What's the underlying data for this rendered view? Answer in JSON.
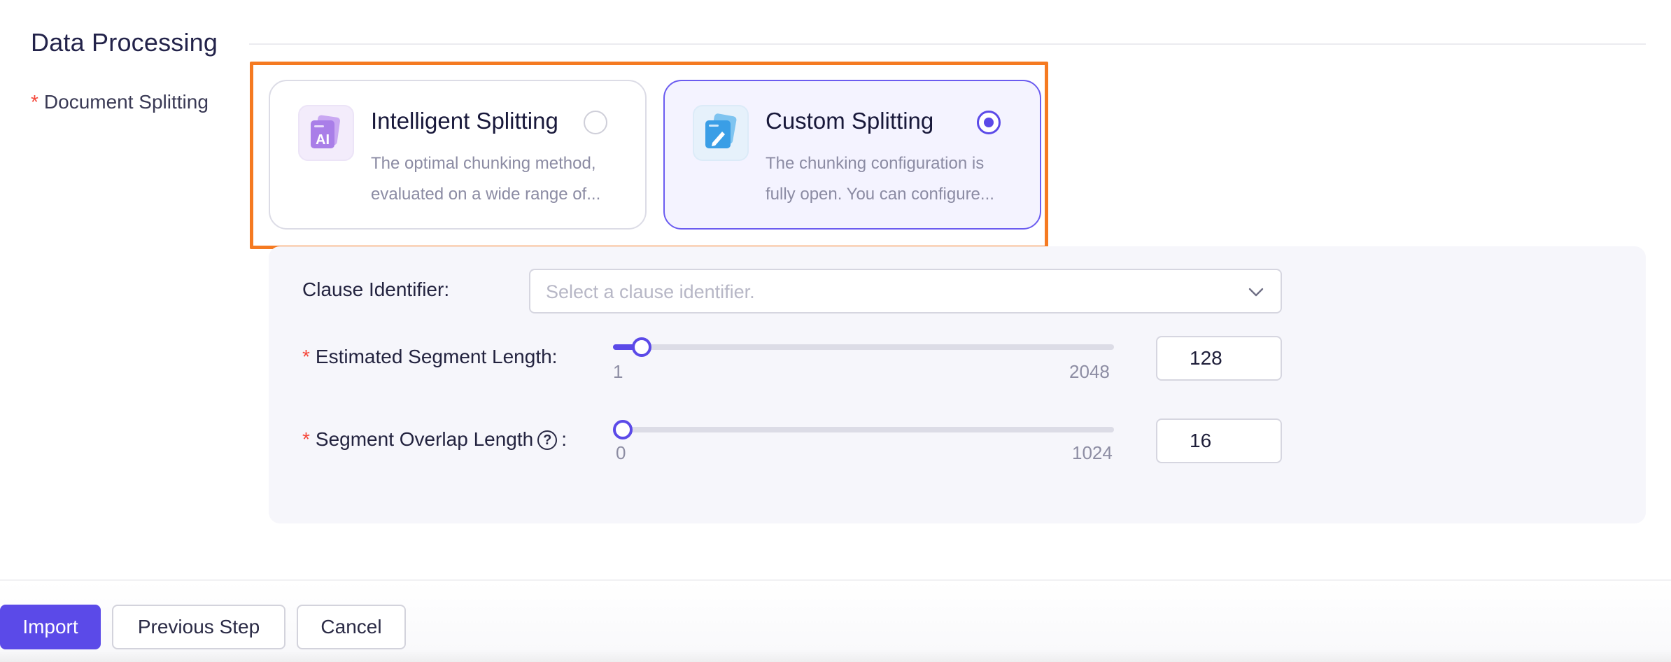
{
  "section": {
    "title": "Data Processing"
  },
  "document_splitting": {
    "required_mark": "*",
    "label": "Document Splitting",
    "options": [
      {
        "title": "Intelligent Splitting",
        "desc_line1": "The optimal chunking method,",
        "desc_line2": "evaluated on a wide range of...",
        "selected": false,
        "icon": "ai-document-icon"
      },
      {
        "title": "Custom Splitting",
        "desc_line1": "The chunking configuration is",
        "desc_line2": "fully open. You can configure...",
        "selected": true,
        "icon": "edit-document-icon"
      }
    ]
  },
  "config": {
    "clause_identifier": {
      "label": "Clause Identifier:",
      "placeholder": "Select a clause identifier."
    },
    "segment_length": {
      "required_mark": "*",
      "label": "Estimated Segment Length:",
      "min": "1",
      "max": "2048",
      "value": "128"
    },
    "overlap_length": {
      "required_mark": "*",
      "label": "Segment Overlap Length",
      "help": "?",
      "colon": ":",
      "min": "0",
      "max": "1024",
      "value": "16"
    }
  },
  "footer": {
    "import_label": "Import",
    "previous_label": "Previous Step",
    "cancel_label": "Cancel"
  },
  "colors": {
    "accent": "#5b4ae8",
    "highlight": "#f57a21",
    "required": "#f5483b"
  }
}
